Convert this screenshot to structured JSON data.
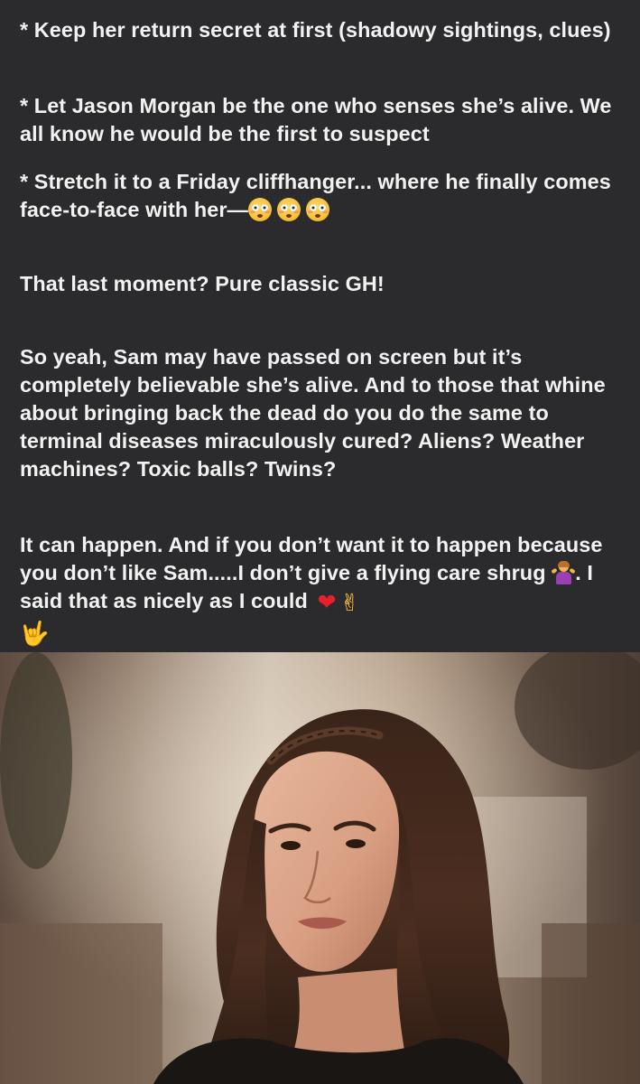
{
  "post": {
    "paragraphs": [
      "* Keep her return secret at first (shadowy sightings, clues)",
      "* Let Jason Morgan be the one who senses she’s alive. We all know he would be the first to suspect",
      "* Stretch it to a Friday cliffhanger... where he finally comes face-to-face with her—",
      "That last moment? Pure classic GH!",
      "So yeah, Sam may have passed on screen but it’s completely believable she’s alive. And to those that whine about bringing back the dead do you do the same to terminal diseases miraculously cured? Aliens? Weather machines? Toxic balls? Twins?",
      "It can happen. And if you don’t want it to happen because you don’t like Sam.....I don’t give a flying care shrug",
      ". I said that as nicely as I could"
    ],
    "emoji": {
      "flushed": "flushed-face-emoji",
      "shrug": "woman-shrugging-emoji",
      "heart": "❤",
      "victory": "✌",
      "love_you": "🤟"
    }
  },
  "photo": {
    "subject": "woman-portrait-photo"
  },
  "colors": {
    "background": "#2b2b2d",
    "text": "#f2f2f2",
    "heart": "#e8202e"
  }
}
